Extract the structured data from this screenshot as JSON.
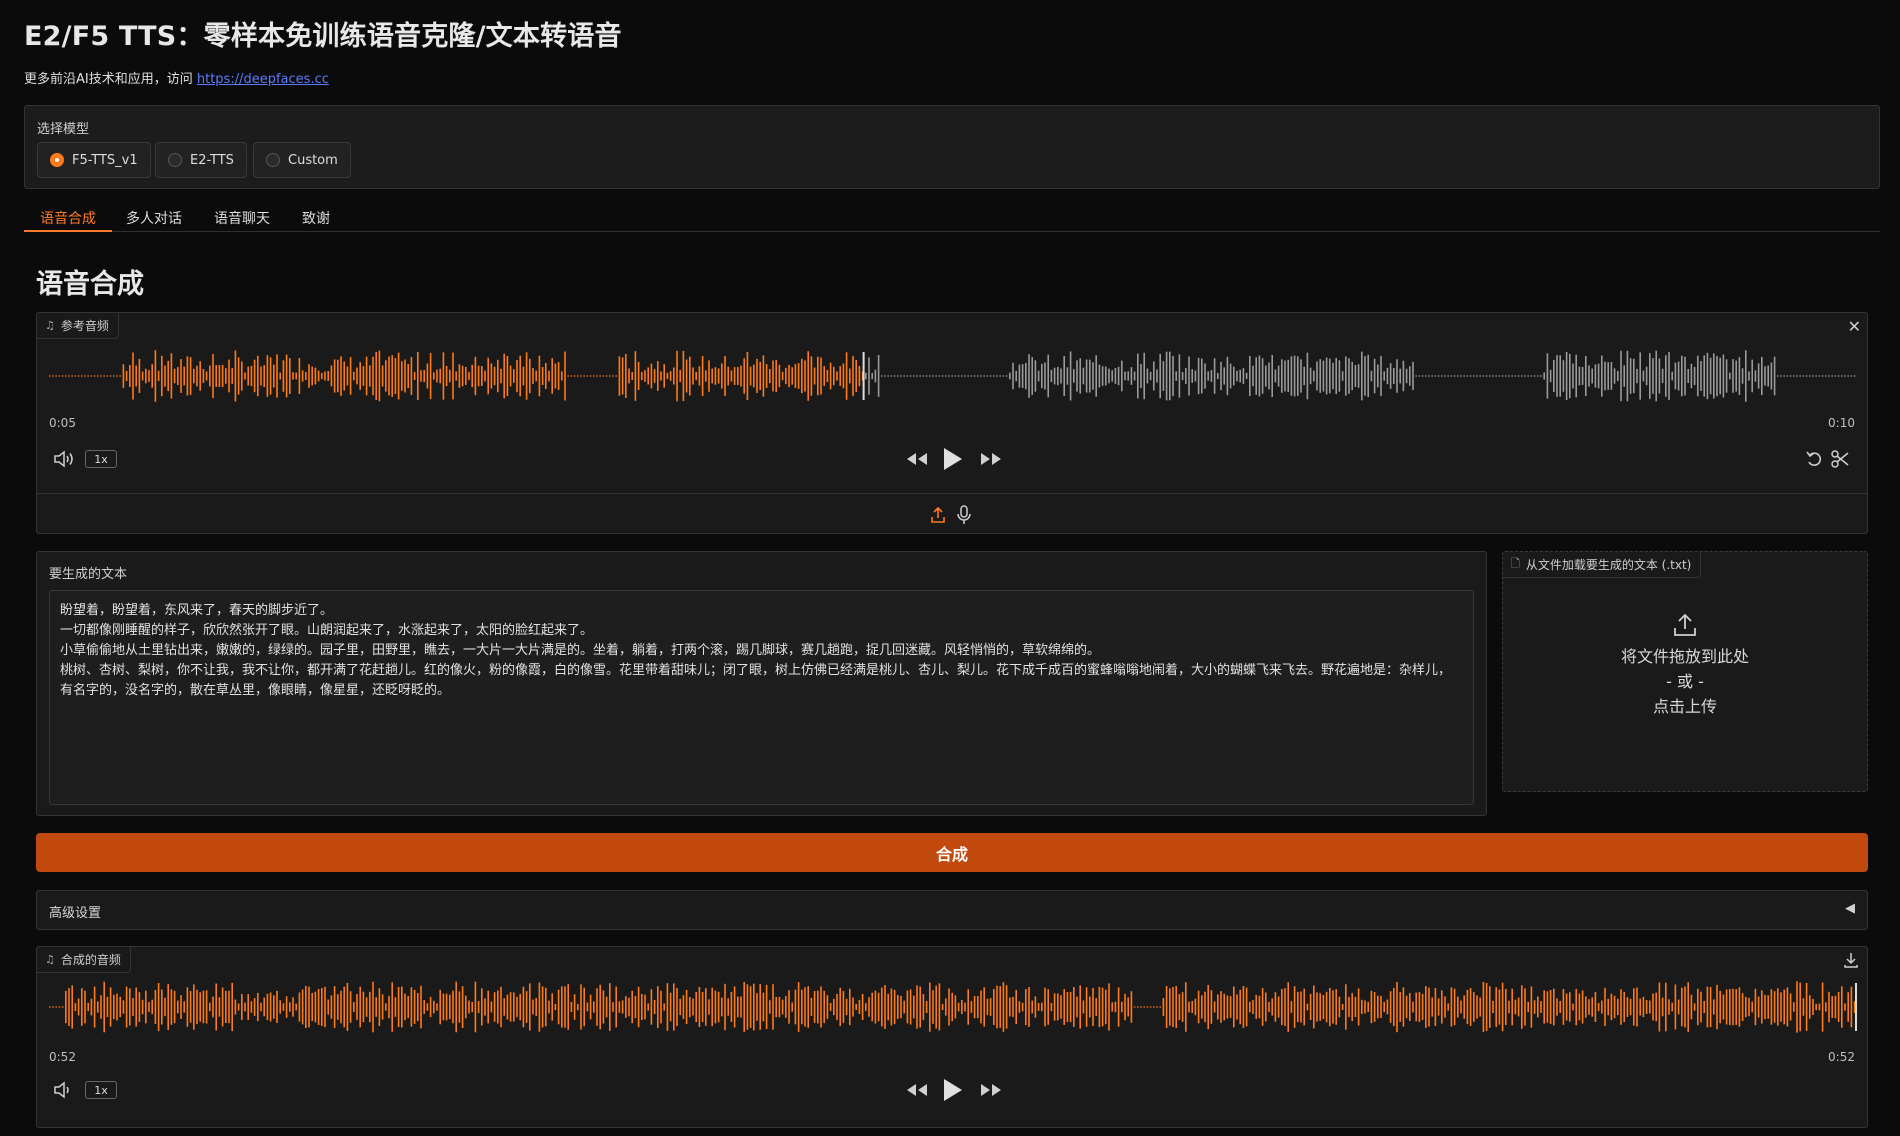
{
  "header": {
    "title": "E2/F5 TTS：零样本免训练语音克隆/文本转语音",
    "subtitle_prefix": "更多前沿AI技术和应用，访问 ",
    "subtitle_link": "https://deepfaces.cc"
  },
  "model_selector": {
    "label": "选择模型",
    "options": [
      "F5-TTS_v1",
      "E2-TTS",
      "Custom"
    ],
    "selected": "F5-TTS_v1"
  },
  "tabs": [
    "语音合成",
    "多人对话",
    "语音聊天",
    "致谢"
  ],
  "active_tab": "语音合成",
  "section_title": "语音合成",
  "ref_audio": {
    "label": "参考音频",
    "time_current": "0:05",
    "time_total": "0:10",
    "speed": "1x",
    "progress": 0.45
  },
  "gen_text": {
    "label": "要生成的文本",
    "value": "盼望着，盼望着，东风来了，春天的脚步近了。\n一切都像刚睡醒的样子，欣欣然张开了眼。山朗润起来了，水涨起来了，太阳的脸红起来了。\n小草偷偷地从土里钻出来，嫩嫩的，绿绿的。园子里，田野里，瞧去，一大片一大片满是的。坐着，躺着，打两个滚，踢几脚球，赛几趟跑，捉几回迷藏。风轻悄悄的，草软绵绵的。\n桃树、杏树、梨树，你不让我，我不让你，都开满了花赶趟儿。红的像火，粉的像霞，白的像雪。花里带着甜味儿；闭了眼，树上仿佛已经满是桃儿、杏儿、梨儿。花下成千成百的蜜蜂嗡嗡地闹着，大小的蝴蝶飞来飞去。野花遍地是：杂样儿，有名字的，没名字的，散在草丛里，像眼睛，像星星，还眨呀眨的。"
  },
  "file_upload": {
    "label": "从文件加载要生成的文本 (.txt)",
    "drop_text": "将文件拖放到此处",
    "or_text": "- 或 -",
    "click_text": "点击上传"
  },
  "synth_button": "合成",
  "advanced": {
    "label": "高级设置",
    "arrow": "◀"
  },
  "out_audio": {
    "label": "合成的音频",
    "time_current": "0:52",
    "time_total": "0:52",
    "speed": "1x",
    "progress": 1.0
  },
  "colors": {
    "accent": "#ff7a18",
    "wave_played": "#ff7a18",
    "wave_unplayed": "#9a9a9a",
    "button": "#c2490d"
  }
}
